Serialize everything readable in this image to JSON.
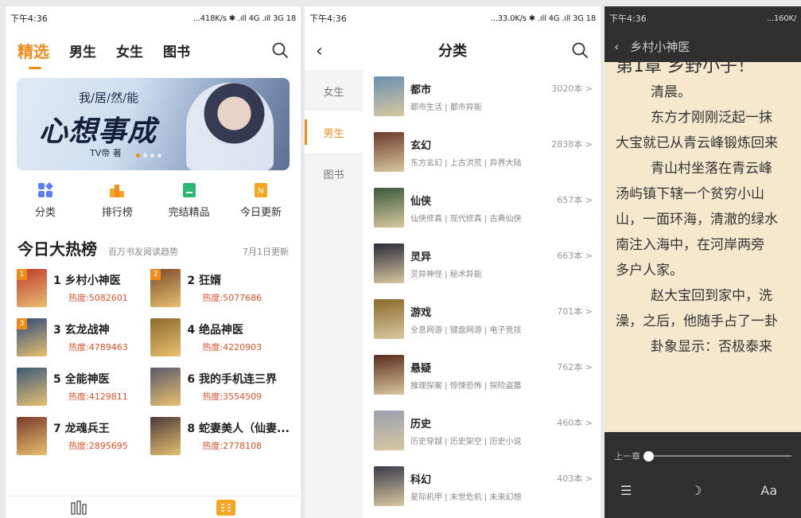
{
  "colors": {
    "accent": "#f08c1c",
    "heat": "#e0502c",
    "reader_bg": "#f5e8cd",
    "dark_bar": "#2f2f2f"
  },
  "screen1": {
    "status": {
      "time": "下午4:36",
      "right": "...418K/s ✱ .ıll 4G .ıll 3G 18"
    },
    "tabs": [
      "精选",
      "男生",
      "女生",
      "图书"
    ],
    "banner": {
      "subtitle": "我/居/然/能",
      "title": "心想事成",
      "author": "TV帝 著"
    },
    "quick": [
      "分类",
      "排行榜",
      "完结精品",
      "今日更新"
    ],
    "hot": {
      "title": "今日大热榜",
      "subtitle": "百万书友阅读趋势",
      "date": "7月1日更新"
    },
    "ranks": [
      {
        "badge": "1",
        "name": "1 乡村小神医",
        "heat": "热度:5082601"
      },
      {
        "badge": "2",
        "name": "2 狂婿",
        "heat": "热度:5077686"
      },
      {
        "badge": "3",
        "name": "3 玄龙战神",
        "heat": "热度:4789463"
      },
      {
        "badge": "",
        "name": "4 绝品神医",
        "heat": "热度:4220903"
      },
      {
        "badge": "",
        "name": "5 全能神医",
        "heat": "热度:4129811"
      },
      {
        "badge": "",
        "name": "6 我的手机连三界",
        "heat": "热度:3554509"
      },
      {
        "badge": "",
        "name": "7 龙魂兵王",
        "heat": "热度:2895695"
      },
      {
        "badge": "",
        "name": "8 蛇妻美人（仙妻...",
        "heat": "热度:2778108"
      }
    ]
  },
  "screen2": {
    "status": {
      "time": "下午4:36",
      "right": "...33.0K/s ✱ .ıll 4G .ıll 3G 18"
    },
    "title": "分类",
    "left_tabs": [
      "女生",
      "男生",
      "图书"
    ],
    "categories": [
      {
        "name": "都市",
        "tags": "都市生活 | 都市异能",
        "count": "3020本 >"
      },
      {
        "name": "玄幻",
        "tags": "东方玄幻 | 上古洪荒 | 异界大陆",
        "count": "2838本 >"
      },
      {
        "name": "仙侠",
        "tags": "仙侠修真 | 现代修真 | 古典仙侠",
        "count": "657本 >"
      },
      {
        "name": "灵异",
        "tags": "灵异神怪 | 秘术异能",
        "count": "663本 >"
      },
      {
        "name": "游戏",
        "tags": "全息网游 | 键盘网游 | 电子竞技",
        "count": "701本 >"
      },
      {
        "name": "悬疑",
        "tags": "推理探案 | 惊悚恐怖 | 探险盗墓",
        "count": "762本 >"
      },
      {
        "name": "历史",
        "tags": "历史穿越 | 历史架空 | 历史小说",
        "count": "460本 >"
      },
      {
        "name": "科幻",
        "tags": "星际机甲 | 末世危机 | 未来幻想",
        "count": "403本 >"
      }
    ]
  },
  "screen3": {
    "status": {
      "time": "下午4:36",
      "right": "...160K/"
    },
    "book_title": "乡村小神医",
    "chapter": "第1章 乡野小子！",
    "lines": [
      "清晨。",
      "东方才刚刚泛起一抹",
      "大宝就已从青云峰锻炼回来",
      "青山村坐落在青云峰",
      "汤屿镇下辖一个贫穷小山",
      "山，一面环海，清澈的绿水",
      "南注入海中，在河岸两旁",
      "多户人家。",
      "赵大宝回到家中，洗",
      "澡，之后，他随手占了一卦",
      "卦象显示：否极泰来"
    ],
    "prev_chapter": "上一章",
    "font_btn": "Aa"
  }
}
